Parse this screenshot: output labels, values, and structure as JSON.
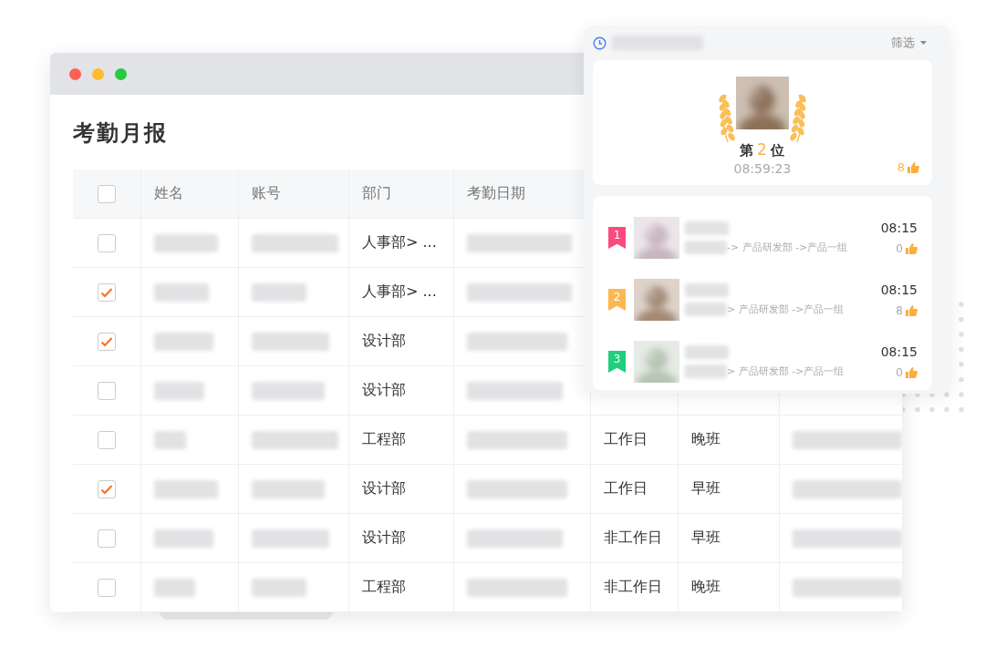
{
  "window": {
    "title": "考勤月报",
    "controls": [
      {
        "color": "#fe5f57"
      },
      {
        "color": "#febc2e"
      },
      {
        "color": "#28c840"
      }
    ]
  },
  "table": {
    "header_checked": false,
    "columns": [
      "姓名",
      "账号",
      "部门",
      "考勤日期"
    ],
    "rows": [
      {
        "checked": false,
        "department": "人事部> ..."
      },
      {
        "checked": true,
        "department": "人事部> ..."
      },
      {
        "checked": true,
        "department": "设计部"
      },
      {
        "checked": false,
        "department": "设计部"
      },
      {
        "checked": false,
        "department": "工程部",
        "column_6": "工作日",
        "column_7": "晚班"
      },
      {
        "checked": true,
        "department": "设计部",
        "column_6": "工作日",
        "column_7": "早班"
      },
      {
        "checked": false,
        "department": "设计部",
        "column_6": "非工作日",
        "column_7": "早班"
      },
      {
        "checked": false,
        "department": "工程部",
        "column_6": "非工作日",
        "column_7": "晚班"
      }
    ]
  },
  "ranking": {
    "filter": "筛选",
    "top": {
      "rank_prefix": "第",
      "rank": "2",
      "rank_suffix": "位",
      "time": "08:59:23",
      "likes": "8"
    },
    "list": [
      {
        "rank": "1",
        "color": "#fb4b7e",
        "path": "-> 产品研发部 ->产品一组",
        "time": "08:15",
        "likes": "0"
      },
      {
        "rank": "2",
        "color": "#fdb750",
        "path": "> 产品研发部 ->产品一组",
        "time": "08:15",
        "likes": "8"
      },
      {
        "rank": "3",
        "color": "#1fcf7c",
        "path": "> 产品研发部 ->产品一组",
        "time": "08:15",
        "likes": "0"
      }
    ]
  }
}
